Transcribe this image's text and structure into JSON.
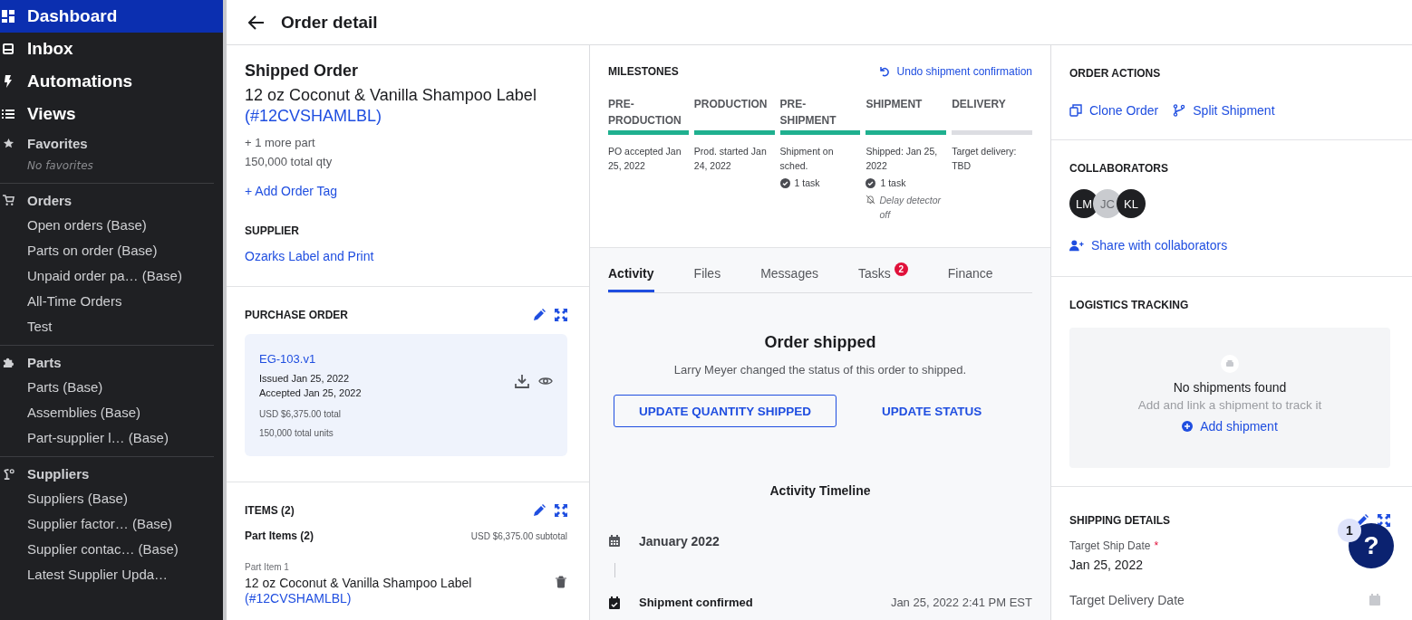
{
  "sidebar": {
    "primary": [
      {
        "label": "Dashboard",
        "kind": "dashboard",
        "selected": true
      },
      {
        "label": "Inbox",
        "kind": "inbox",
        "selected": false
      },
      {
        "label": "Automations",
        "kind": "automation",
        "selected": false
      },
      {
        "label": "Views",
        "kind": "views",
        "selected": false
      }
    ],
    "favorites": {
      "title": "Favorites",
      "empty": "No favorites"
    },
    "groups": [
      {
        "title": "Orders",
        "kind": "orders",
        "items": [
          "Open orders (Base)",
          "Parts on order (Base)",
          "Unpaid order pa… (Base)",
          "All-Time Orders",
          "Test"
        ]
      },
      {
        "title": "Parts",
        "kind": "parts",
        "items": [
          "Parts (Base)",
          "Assemblies (Base)",
          "Part-supplier l… (Base)"
        ]
      },
      {
        "title": "Suppliers",
        "kind": "suppliers",
        "items": [
          "Suppliers (Base)",
          "Supplier factor… (Base)",
          "Supplier contac… (Base)",
          "Latest Supplier Upda…"
        ]
      }
    ]
  },
  "header": {
    "title": "Order detail"
  },
  "order": {
    "status": "Shipped Order",
    "part_name": "12 oz Coconut & Vanilla Shampoo Label",
    "part_code": "(#12CVSHAMLBL)",
    "more_parts": "+ 1 more part",
    "total_qty": "150,000 total qty",
    "add_tag": "+ Add Order Tag"
  },
  "supplier": {
    "heading": "SUPPLIER",
    "name": "Ozarks Label and Print"
  },
  "purchase_order": {
    "heading": "PURCHASE ORDER",
    "number": "EG-103.v1",
    "issued": "Issued Jan 25, 2022",
    "accepted": "Accepted Jan 25, 2022",
    "total": "USD $6,375.00 total",
    "units": "150,000 total units"
  },
  "items": {
    "heading": "ITEMS (2)",
    "subheading": "Part Items (2)",
    "subtotal": "USD $6,375.00 subtotal",
    "part_items": [
      {
        "label": "Part Item 1",
        "name": "12 oz Coconut & Vanilla Shampoo Label",
        "code": "(#12CVSHAMLBL)"
      }
    ]
  },
  "milestones": {
    "heading": "MILESTONES",
    "undo": "Undo shipment confirmation",
    "stages": [
      {
        "title": "PRE-PRODUCTION",
        "complete": true,
        "status": "PO accepted Jan 25, 2022"
      },
      {
        "title": "PRODUCTION",
        "complete": true,
        "status": "Prod. started Jan 24, 2022"
      },
      {
        "title": "PRE-SHIPMENT",
        "complete": true,
        "status": "Shipment on sched.",
        "tasks": "1 task"
      },
      {
        "title": "SHIPMENT",
        "complete": true,
        "status": "Shipped: Jan 25, 2022",
        "tasks": "1 task",
        "delay": "Delay detector off"
      },
      {
        "title": "DELIVERY",
        "complete": false,
        "status": "Target delivery: TBD"
      }
    ]
  },
  "tabs": [
    {
      "label": "Activity",
      "selected": true
    },
    {
      "label": "Files",
      "selected": false
    },
    {
      "label": "Messages",
      "selected": false
    },
    {
      "label": "Tasks",
      "selected": false,
      "badge": "2"
    },
    {
      "label": "Finance",
      "selected": false
    }
  ],
  "activity": {
    "title": "Order shipped",
    "message": "Larry Meyer changed the status of this order to shipped.",
    "buttons": [
      {
        "label": "UPDATE QUANTITY SHIPPED",
        "kind": "outlined"
      },
      {
        "label": "UPDATE STATUS",
        "kind": "text"
      }
    ],
    "timeline_title": "Activity Timeline",
    "month": "January 2022",
    "events": [
      {
        "title": "Shipment confirmed",
        "time": "Jan 25, 2022 2:41 PM EST"
      }
    ]
  },
  "order_actions": {
    "heading": "ORDER ACTIONS",
    "actions": [
      {
        "label": "Clone Order",
        "kind": "clone"
      },
      {
        "label": "Split Shipment",
        "kind": "split"
      }
    ]
  },
  "collaborators": {
    "heading": "COLLABORATORS",
    "people": [
      {
        "initials": "LM",
        "color": "#1f2023"
      },
      {
        "initials": "JC",
        "color": "#c9cbcf"
      },
      {
        "initials": "KL",
        "color": "#1f2023"
      }
    ],
    "share": "Share with collaborators"
  },
  "logistics": {
    "heading": "LOGISTICS TRACKING",
    "empty_title": "No shipments found",
    "empty_hint": "Add and link a shipment to track it",
    "add": "Add shipment"
  },
  "shipping": {
    "heading": "SHIPPING DETAILS",
    "fields": [
      {
        "label": "Target Ship Date",
        "required_marker": "*",
        "value": "Jan 25, 2022"
      },
      {
        "label": "Target Delivery Date"
      }
    ]
  },
  "help": {
    "label": "?",
    "badge": "1"
  }
}
